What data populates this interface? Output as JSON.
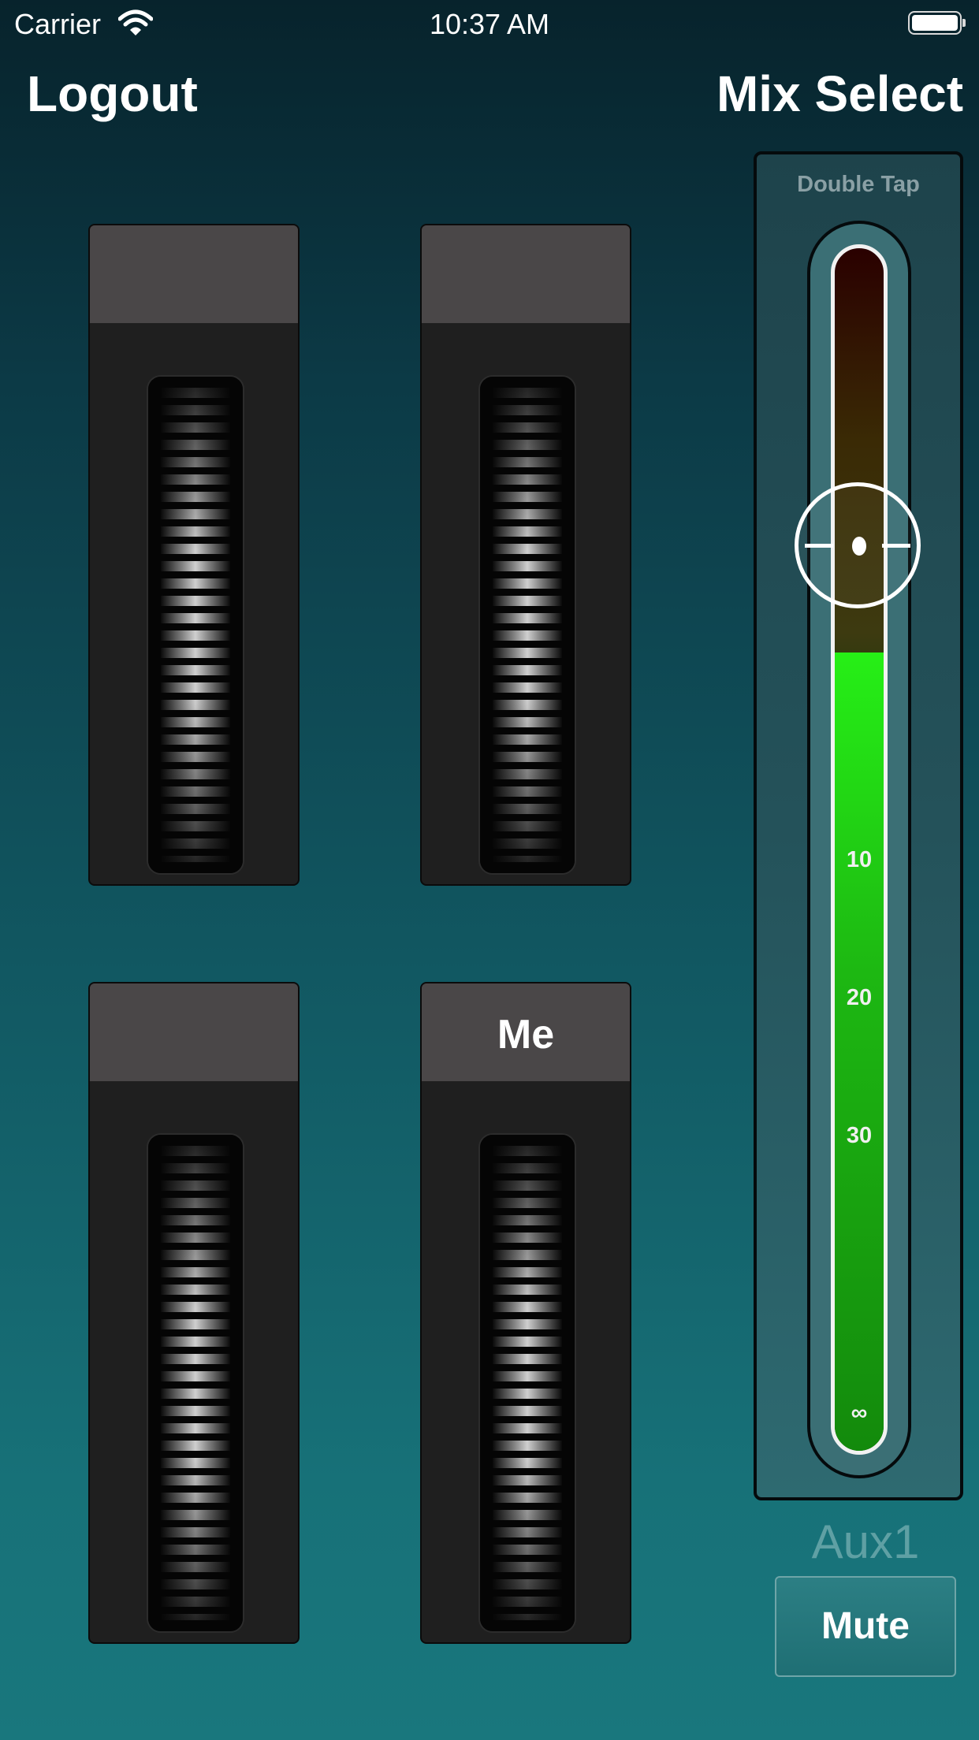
{
  "status_bar": {
    "carrier": "Carrier",
    "time": "10:37 AM"
  },
  "nav": {
    "left": "Logout",
    "right": "Mix Select"
  },
  "strips": [
    {
      "label": ""
    },
    {
      "label": ""
    },
    {
      "label": ""
    },
    {
      "label": "Me"
    }
  ],
  "mixer": {
    "hint": "Double Tap",
    "scale": [
      "10",
      "20",
      "30",
      "∞"
    ],
    "channel": "Aux1",
    "mute_label": "Mute"
  },
  "colors": {
    "meter_green": "#26ef16",
    "background": "#115761"
  }
}
